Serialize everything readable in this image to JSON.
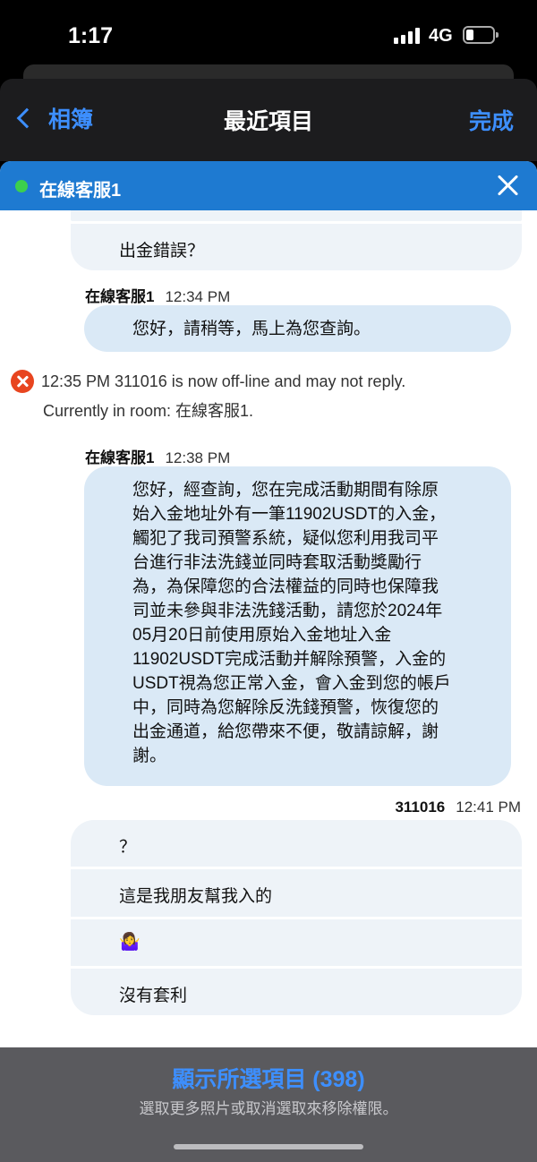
{
  "status_bar": {
    "time": "1:17",
    "network": "4G"
  },
  "nav": {
    "back_label": "相簿",
    "title": "最近項目",
    "done_label": "完成"
  },
  "chat": {
    "header_title": "在線客服1",
    "msg_top": "出金錯誤？",
    "agent_msg1": {
      "sender": "在線客服1",
      "time": "12:34 PM",
      "text": "您好，請稍等，馬上為您查詢。"
    },
    "system": {
      "line1": "12:35 PM  311016 is now off-line and may not reply.",
      "line2": "Currently in room: 在線客服1."
    },
    "agent_msg2": {
      "sender": "在線客服1",
      "time": "12:38 PM",
      "lines": [
        "您好，經查詢，您在完成活動期間有除原",
        "始入金地址外有一筆11902USDT的入金，",
        "觸犯了我司預警系統，疑似您利用我司平",
        "台進行非法洗錢並同時套取活動獎勵行",
        "為，為保障您的合法權益的同時也保障我",
        "司並未參與非法洗錢活動，請您於2024年",
        "05月20日前使用原始入金地址入金",
        "11902USDT完成活動并解除預警，入金的",
        "USDT視為您正常入金，會入金到您的帳戶",
        "中，同時為您解除反洗錢預警，恢復您的",
        "出金通道，給您帶來不便，敬請諒解，謝",
        "謝。"
      ]
    },
    "user_group": {
      "sender": "311016",
      "time": "12:41 PM",
      "messages": [
        "？",
        "這是我朋友幫我入的",
        "🤷‍♀️",
        "沒有套利"
      ]
    }
  },
  "bottom": {
    "show_selected": "顯示所選項目 (398)",
    "hint": "選取更多照片或取消選取來移除權限。"
  }
}
